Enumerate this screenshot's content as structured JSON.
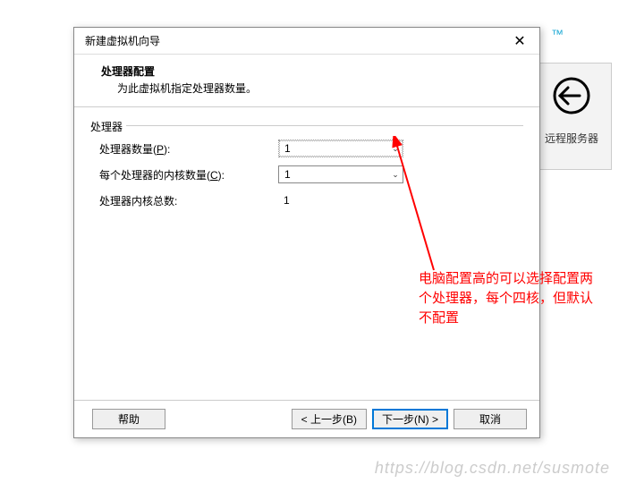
{
  "background": {
    "tm_text": "™",
    "remote_server_label": "远程服务器"
  },
  "dialog": {
    "title": "新建虚拟机向导",
    "header": {
      "title": "处理器配置",
      "subtitle": "为此虚拟机指定处理器数量。"
    },
    "group": {
      "label": "处理器",
      "processor_count_label": "处理器数量(",
      "processor_count_mnemonic": "P",
      "processor_count_suffix": "):",
      "processor_count_value": "1",
      "cores_label": "每个处理器的内核数量(",
      "cores_mnemonic": "C",
      "cores_suffix": "):",
      "cores_value": "1",
      "total_label": "处理器内核总数:",
      "total_value": "1"
    },
    "buttons": {
      "help": "帮助",
      "back": "< 上一步(B)",
      "next": "下一步(N) >",
      "cancel": "取消"
    }
  },
  "annotation": "电脑配置高的可以选择配置两个处理器，每个四核，但默认不配置",
  "watermark": "https://blog.csdn.net/susmote"
}
